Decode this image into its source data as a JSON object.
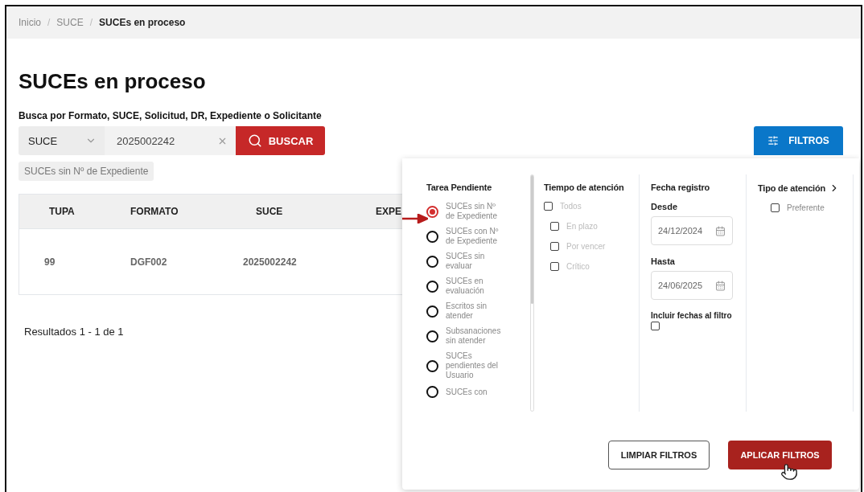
{
  "breadcrumb": [
    {
      "label": "Inicio",
      "current": false
    },
    {
      "label": "SUCE",
      "current": false
    },
    {
      "label": "SUCEs en proceso",
      "current": true
    }
  ],
  "breadcrumb_separator": "/",
  "title": "SUCEs en proceso",
  "search": {
    "label": "Busca por Formato, SUCE, Solicitud, DR, Expediente o Solicitante",
    "type": "SUCE",
    "value": "2025002242",
    "button": "BUSCAR"
  },
  "chips": [
    "SUCEs sin Nº de Expediente"
  ],
  "filters_button": "FILTROS",
  "table": {
    "columns": [
      "TUPA",
      "FORMATO",
      "SUCE",
      "EXPE"
    ],
    "rows": [
      [
        "99",
        "DGF002",
        "2025002242"
      ]
    ]
  },
  "results": "Resultados 1 - 1 de 1",
  "filter_panel": {
    "tarea": {
      "title": "Tarea Pendiente",
      "options": [
        {
          "label": "SUCEs sin Nº de Expediente",
          "selected": true
        },
        {
          "label": "SUCEs con Nº de Expediente",
          "selected": false
        },
        {
          "label": "SUCEs sin evaluar",
          "selected": false
        },
        {
          "label": "SUCEs en evaluación",
          "selected": false
        },
        {
          "label": "Escritos sin atender",
          "selected": false
        },
        {
          "label": "Subsanaciones sin atender",
          "selected": false
        },
        {
          "label": "SUCEs pendientes del Usuario",
          "selected": false
        },
        {
          "label": "SUCEs con",
          "selected": false
        }
      ]
    },
    "tiempo": {
      "title": "Tiempo de atención",
      "options": [
        {
          "label": "Todos",
          "checked": false,
          "disabled": true,
          "children": [
            {
              "label": "En plazo",
              "checked": false,
              "disabled": true
            },
            {
              "label": "Por vencer",
              "checked": false,
              "disabled": true
            },
            {
              "label": "Crítico",
              "checked": false,
              "disabled": true
            }
          ]
        }
      ]
    },
    "fecha": {
      "title": "Fecha registro",
      "from_label": "Desde",
      "from": "24/12/2024",
      "to_label": "Hasta",
      "to": "24/06/2025",
      "include_label": "Incluir fechas al filtro",
      "include_checked": false
    },
    "tipo": {
      "title": "Tipo de atención",
      "options": [
        {
          "label": "Preferente",
          "checked": false,
          "disabled": false
        }
      ]
    },
    "buttons": [
      "LIMPIAR FILTROS",
      "APLICAR FILTROS"
    ]
  }
}
